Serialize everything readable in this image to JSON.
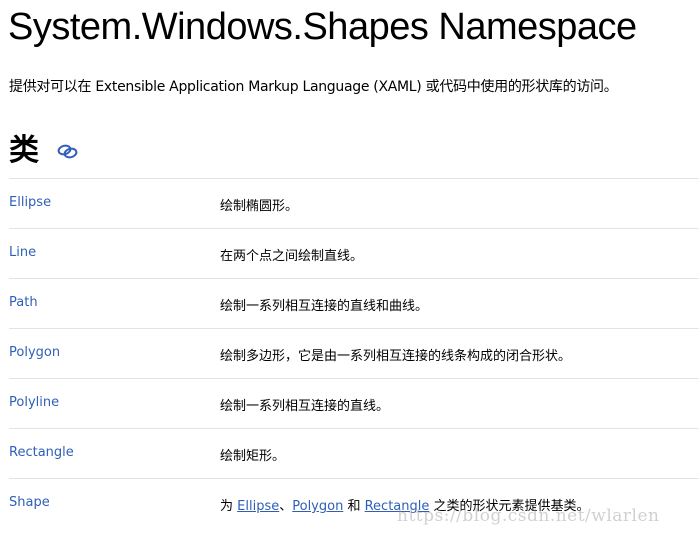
{
  "page": {
    "title": "System.Windows.Shapes Namespace",
    "subtitle": "提供对可以在 Extensible Application Markup Language (XAML) 或代码中使用的形状库的访问。",
    "section_heading": "类",
    "anchor_icon": "link-icon",
    "link_color": "#2f5fb8"
  },
  "classes": [
    {
      "name": "Ellipse",
      "description": "绘制椭圆形。"
    },
    {
      "name": "Line",
      "description": "在两个点之间绘制直线。"
    },
    {
      "name": "Path",
      "description": "绘制一系列相互连接的直线和曲线。"
    },
    {
      "name": "Polygon",
      "description": "绘制多边形，它是由一系列相互连接的线条构成的闭合形状。"
    },
    {
      "name": "Polyline",
      "description": "绘制一系列相互连接的直线。"
    },
    {
      "name": "Rectangle",
      "description": "绘制矩形。"
    },
    {
      "name": "Shape",
      "description_parts": {
        "prefix": "为 ",
        "link1": "Ellipse",
        "sep1": "、",
        "link2": "Polygon",
        "sep2": " 和 ",
        "link3": "Rectangle",
        "suffix": " 之类的形状元素提供基类。"
      }
    }
  ],
  "watermark": "https://blog.csdn.net/wlarlen"
}
